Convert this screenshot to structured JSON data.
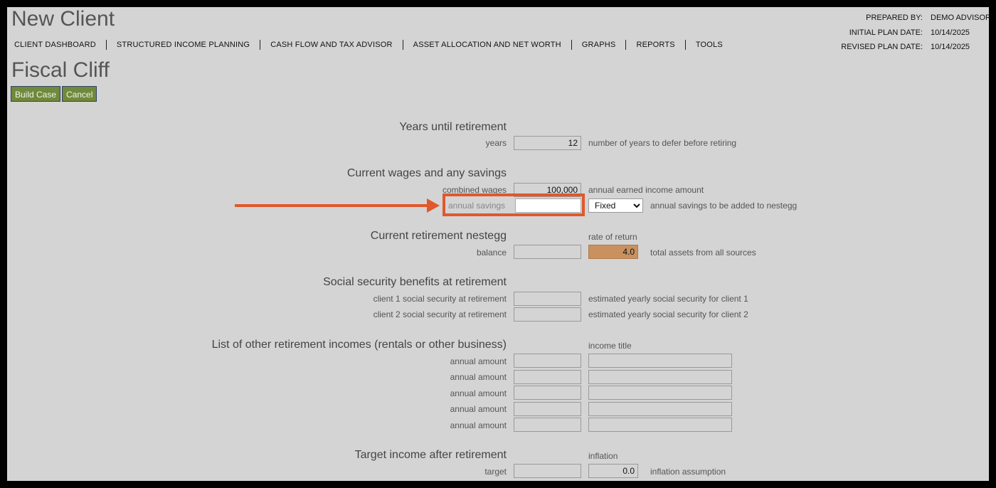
{
  "header": {
    "app_title": "New Client",
    "page_title": "Fiscal Cliff",
    "prepared_by_label": "PREPARED BY:",
    "prepared_by_value": "DEMO ADVISOR",
    "initial_date_label": "INITIAL PLAN DATE:",
    "initial_date_value": "10/14/2025",
    "revised_date_label": "REVISED PLAN DATE:",
    "revised_date_value": "10/14/2025"
  },
  "nav": [
    "CLIENT DASHBOARD",
    "STRUCTURED INCOME PLANNING",
    "CASH FLOW AND TAX ADVISOR",
    "ASSET ALLOCATION AND NET WORTH",
    "GRAPHS",
    "REPORTS",
    "TOOLS"
  ],
  "buttons": {
    "build_case": "Build Case",
    "cancel": "Cancel"
  },
  "years": {
    "title": "Years until retirement",
    "label": "years",
    "value": "12",
    "desc": "number of years to defer before retiring"
  },
  "wages": {
    "title": "Current wages and any savings",
    "combined_label": "combined wages",
    "combined_value": "100,000",
    "combined_desc": "annual earned income amount",
    "savings_label": "annual savings",
    "savings_value": "",
    "savings_mode": "Fixed",
    "savings_desc": "annual savings to be added to nestegg"
  },
  "nestegg": {
    "title": "Current retirement nestegg",
    "rate_header": "rate of return",
    "balance_label": "balance",
    "balance_value": "",
    "rate_value": "4.0",
    "desc": "total assets from all sources"
  },
  "social_security": {
    "title": "Social security benefits at retirement",
    "c1_label": "client 1 social security at retirement",
    "c1_desc": "estimated yearly social security for client 1",
    "c2_label": "client 2 social security at retirement",
    "c2_desc": "estimated yearly social security for client 2"
  },
  "other_incomes": {
    "title": "List of other retirement incomes (rentals or other business)",
    "income_title_header": "income title",
    "rows": [
      "annual amount",
      "annual amount",
      "annual amount",
      "annual amount",
      "annual amount"
    ]
  },
  "target": {
    "title": "Target income after retirement",
    "inflation_header": "inflation",
    "label": "target",
    "inflation_value": "0.0",
    "desc": "inflation assumption"
  },
  "colors": {
    "accent": "#e0582c",
    "button": "#6f8a3a",
    "highlight": "#c8915f"
  }
}
